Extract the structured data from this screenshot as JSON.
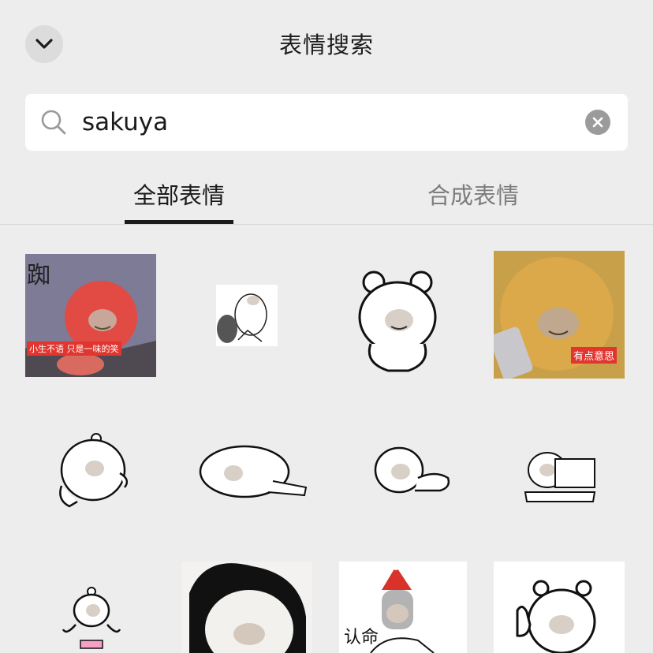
{
  "header": {
    "title": "表情搜索",
    "back_icon": "chevron-down-icon"
  },
  "search": {
    "query": "sakuya",
    "search_icon": "search-icon",
    "clear_icon": "clear-icon"
  },
  "tabs": [
    {
      "label": "全部表情",
      "active": true
    },
    {
      "label": "合成表情",
      "active": false
    }
  ],
  "stickers": [
    {
      "caption": "小生不语 只是一味的笑",
      "extra_text": "踟"
    },
    {
      "caption": ""
    },
    {
      "caption": ""
    },
    {
      "caption": "有点意思"
    },
    {
      "caption": ""
    },
    {
      "caption": ""
    },
    {
      "caption": ""
    },
    {
      "caption": ""
    },
    {
      "caption": ""
    },
    {
      "caption": ""
    },
    {
      "caption": "认命"
    },
    {
      "caption": ""
    }
  ],
  "colors": {
    "background": "#ededed",
    "active_tab": "#1b1b1b",
    "inactive_tab": "#7d7d7d",
    "caption_bg": "#e0362f"
  }
}
